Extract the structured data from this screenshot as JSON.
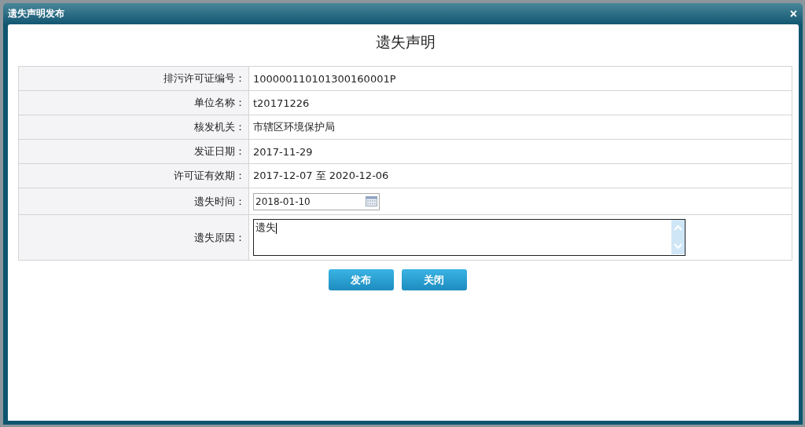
{
  "window": {
    "title": "遗失声明发布",
    "close": "×"
  },
  "heading": "遗失声明",
  "rows": [
    {
      "kind": "text",
      "label": "排污许可证编号：",
      "value": "100000110101300160001P"
    },
    {
      "kind": "text",
      "label": "单位名称：",
      "value": "t20171226"
    },
    {
      "kind": "text",
      "label": "核发机关：",
      "value": "市辖区环境保护局"
    },
    {
      "kind": "text",
      "label": "发证日期：",
      "value": "2017-11-29"
    },
    {
      "kind": "text",
      "label": "许可证有效期：",
      "value": "2017-12-07 至 2020-12-06"
    },
    {
      "kind": "date",
      "label": "遗失时间：",
      "value": "2018-01-10"
    },
    {
      "kind": "textarea",
      "label": "遗失原因：",
      "value": "遗失"
    }
  ],
  "buttons": [
    "发布",
    "关闭"
  ]
}
